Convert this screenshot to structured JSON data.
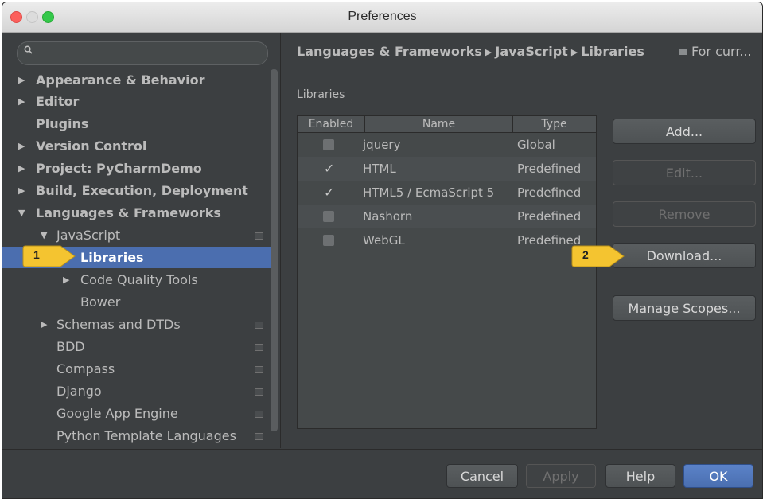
{
  "window": {
    "title": "Preferences"
  },
  "sidebar": {
    "search_placeholder": "",
    "items": [
      {
        "label": "Appearance & Behavior",
        "arrow": "▶"
      },
      {
        "label": "Editor",
        "arrow": "▶"
      },
      {
        "label": "Plugins",
        "arrow": ""
      },
      {
        "label": "Version Control",
        "arrow": "▶"
      },
      {
        "label": "Project: PyCharmDemo",
        "arrow": "▶"
      },
      {
        "label": "Build, Execution, Deployment",
        "arrow": "▶"
      },
      {
        "label": "Languages & Frameworks",
        "arrow": "▼"
      },
      {
        "label": "JavaScript",
        "arrow": "▼"
      },
      {
        "label": "Libraries",
        "arrow": ""
      },
      {
        "label": "Code Quality Tools",
        "arrow": "▶"
      },
      {
        "label": "Bower",
        "arrow": ""
      },
      {
        "label": "Schemas and DTDs",
        "arrow": "▶"
      },
      {
        "label": "BDD",
        "arrow": ""
      },
      {
        "label": "Compass",
        "arrow": ""
      },
      {
        "label": "Django",
        "arrow": ""
      },
      {
        "label": "Google App Engine",
        "arrow": ""
      },
      {
        "label": "Python Template Languages",
        "arrow": ""
      }
    ]
  },
  "content": {
    "breadcrumb": [
      "Languages & Frameworks",
      "JavaScript",
      "Libraries"
    ],
    "breadcrumb_sep": "▶",
    "scope_note": "For curr...",
    "group_label": "Libraries",
    "table": {
      "headers": [
        "Enabled",
        "Name",
        "Type"
      ],
      "rows": [
        {
          "enabled": false,
          "name": "jquery",
          "type": "Global"
        },
        {
          "enabled": true,
          "name": "HTML",
          "type": "Predefined"
        },
        {
          "enabled": true,
          "name": "HTML5 / EcmaScript 5",
          "type": "Predefined"
        },
        {
          "enabled": false,
          "name": "Nashorn",
          "type": "Predefined"
        },
        {
          "enabled": false,
          "name": "WebGL",
          "type": "Predefined"
        }
      ],
      "check_glyph": "✓"
    },
    "buttons": {
      "add": "Add...",
      "edit": "Edit...",
      "remove": "Remove",
      "download": "Download...",
      "manage_scopes": "Manage Scopes..."
    }
  },
  "footer": {
    "cancel": "Cancel",
    "apply": "Apply",
    "help": "Help",
    "ok": "OK"
  },
  "callouts": {
    "one": "1",
    "two": "2"
  },
  "colors": {
    "selection": "#4b6eaf",
    "callout": "#f4c430",
    "primary": "#4a6fb0"
  }
}
